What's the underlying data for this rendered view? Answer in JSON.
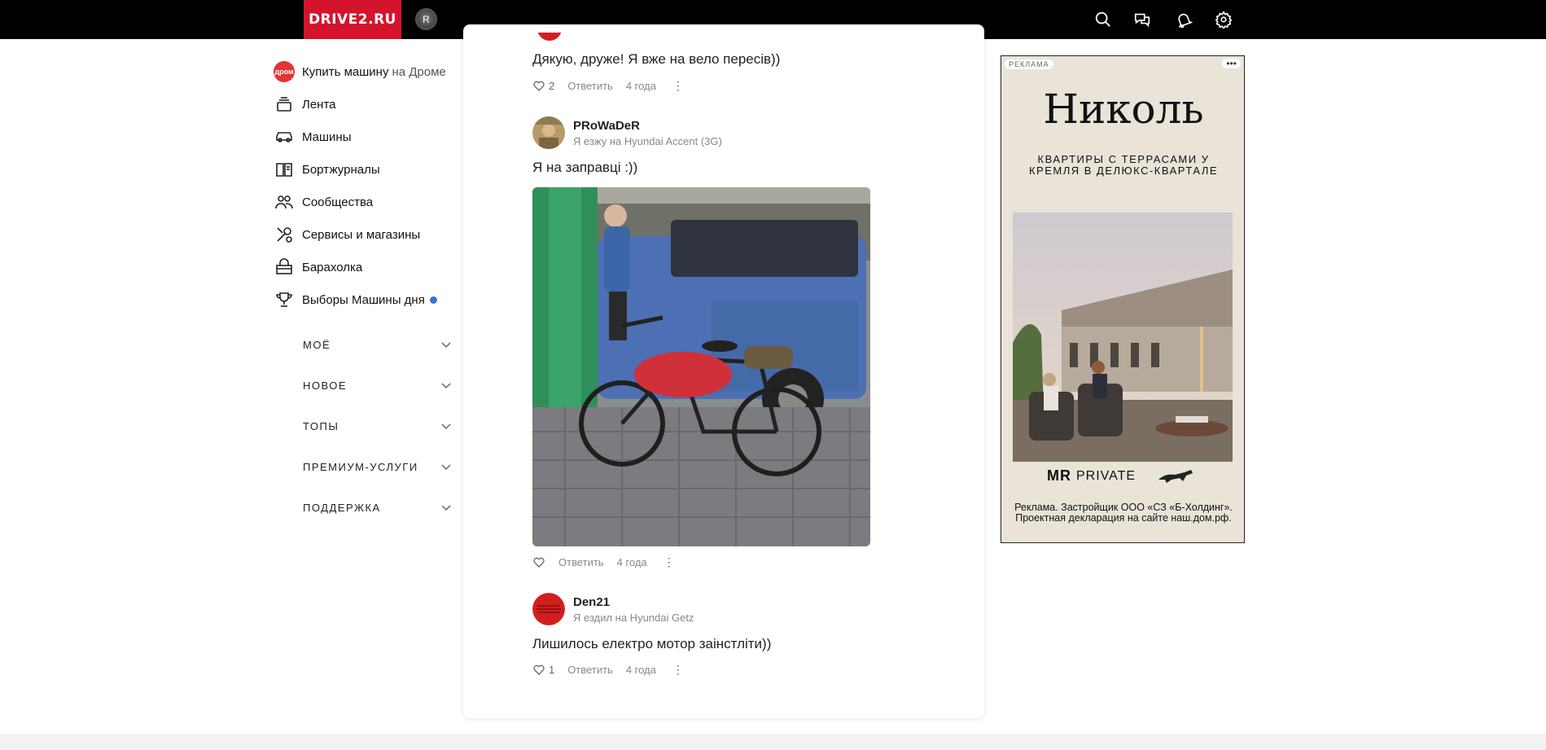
{
  "header": {
    "logo": "DRIVE2.RU",
    "avatar_letter": "R",
    "icons": [
      "search-icon",
      "messages-icon",
      "notifications-icon",
      "settings-icon"
    ]
  },
  "nav": {
    "items": [
      {
        "label": "Купить машину",
        "sub": "на Дроме",
        "icon": "drom-icon"
      },
      {
        "label": "Лента",
        "icon": "feed-icon"
      },
      {
        "label": "Машины",
        "icon": "car-icon"
      },
      {
        "label": "Бортжурналы",
        "icon": "logbook-icon"
      },
      {
        "label": "Сообщества",
        "icon": "communities-icon"
      },
      {
        "label": "Сервисы и магазины",
        "icon": "tools-icon"
      },
      {
        "label": "Барахолка",
        "icon": "market-icon"
      },
      {
        "label": "Выборы Машины дня",
        "icon": "trophy-icon"
      }
    ],
    "sections": [
      "МОЁ",
      "НОВОЕ",
      "ТОПЫ",
      "ПРЕМИУМ-УСЛУГИ",
      "ПОДДЕРЖКА"
    ]
  },
  "comments": [
    {
      "text": "Дякую, друже! Я вже на вело пересів))",
      "likes": "2",
      "reply": "Ответить",
      "time": "4 года"
    },
    {
      "author": "PRoWaDeR",
      "car": "Я езжу на Hyundai Accent (3G)",
      "text": "Я на заправці :))",
      "reply": "Ответить",
      "time": "4 года"
    },
    {
      "author": "Den21",
      "car": "Я ездил на Hyundai Getz",
      "text": "Лишилось електро мотор заінстліти))",
      "likes": "1",
      "reply": "Ответить",
      "time": "4 года"
    }
  ],
  "ad": {
    "label": "РЕКЛАМА",
    "more": "•••",
    "title": "Николь",
    "subtitle": "КВАРТИРЫ С ТЕРРАСАМИ У КРЕМЛЯ В ДЕЛЮКС-КВАРТАЛЕ",
    "brand_mark": "MR",
    "brand_text": "PRIVATE",
    "legal": "Реклама. Застройщик ООО «СЗ «Б-Холдинг». Проектная декларация на сайте наш.дом.рф."
  },
  "colors": {
    "brand_red": "#d4142c",
    "topbar": "#000000",
    "accent_dot": "#3b6ed8"
  }
}
